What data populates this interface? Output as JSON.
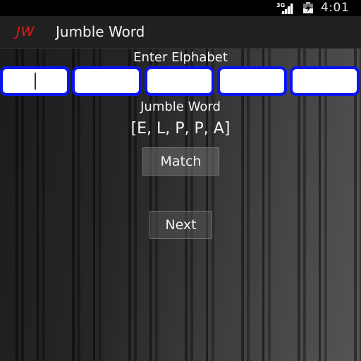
{
  "status_bar": {
    "network_label": "3G",
    "signal_icon": "signal-bars-icon",
    "battery_icon": "battery-charging-icon",
    "time": "4:01"
  },
  "action_bar": {
    "logo": "JW",
    "title": "Jumble Word",
    "colors": {
      "logo": "#e01818",
      "background": "#212121"
    }
  },
  "main": {
    "enter_label": "Enter Elphabet",
    "letter_inputs": [
      {
        "value": "",
        "focused": true
      },
      {
        "value": "",
        "focused": false
      },
      {
        "value": "",
        "focused": false
      },
      {
        "value": "",
        "focused": false
      },
      {
        "value": "",
        "focused": false
      }
    ],
    "jumble_label": "Jumble Word",
    "jumbled_letters": "[E, L, P, P, A]",
    "match_button": "Match",
    "next_button": "Next",
    "colors": {
      "input_border": "#0a14f0",
      "input_fill": "#ffffff"
    }
  }
}
